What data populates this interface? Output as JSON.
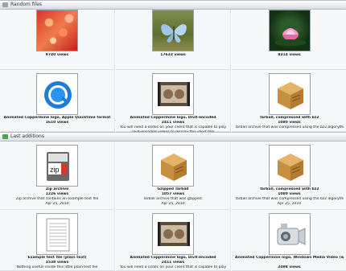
{
  "sections": {
    "random": {
      "title": "Random files"
    },
    "last": {
      "title": "Last additions"
    }
  },
  "random_files": [
    {
      "title": "",
      "views": "9740 views",
      "desc": ""
    },
    {
      "title": "",
      "views": "17633 views",
      "desc": ""
    },
    {
      "title": "",
      "views": "8314 views",
      "desc": ""
    },
    {
      "title": "Animated Coppermine logo, Apple Quicktime format",
      "views": "1610 views",
      "desc": ""
    },
    {
      "title": "Animated Coppermine logo, DivX-encoded",
      "views": "2411 views",
      "desc": "You will need a codec on your client that is capable to play",
      "desc2": "DivX-encoded videos to display this short film"
    },
    {
      "title": "Tarball, compressed with bz2",
      "views": "1080 views",
      "desc": "Tarball archive that was compressed using the bz2 algorythm"
    }
  ],
  "last_additions": [
    {
      "title": "Zip archive",
      "views": "1226 views",
      "desc": "Zip archive that contains an example text file",
      "date": "Apr 25, 2010"
    },
    {
      "title": "Gzipped Tarball",
      "views": "1057 views",
      "desc": "Tarball archive that was gzipped.",
      "date": "Apr 25, 2010"
    },
    {
      "title": "Tarball, compressed with bz2",
      "views": "1080 views",
      "desc": "Tarball archive that was compressed using the bz2 algorythm",
      "date": "Apr 25, 2010"
    },
    {
      "title": "Example text file (plain text)",
      "views": "1538 views",
      "desc": "Nothing usefull inside this little plain text file",
      "date": ""
    },
    {
      "title": "Animated Coppermine logo, DivX-encoded",
      "views": "2411 views",
      "desc": "You will need a codec on your client that is capable to play",
      "date": ""
    },
    {
      "title": "Animated Coppermine logo, Windows Media Video (wmv)-encoded",
      "views": "2498 views",
      "desc": "",
      "date": ""
    }
  ],
  "thumb_text": {
    "zip": "zip"
  }
}
